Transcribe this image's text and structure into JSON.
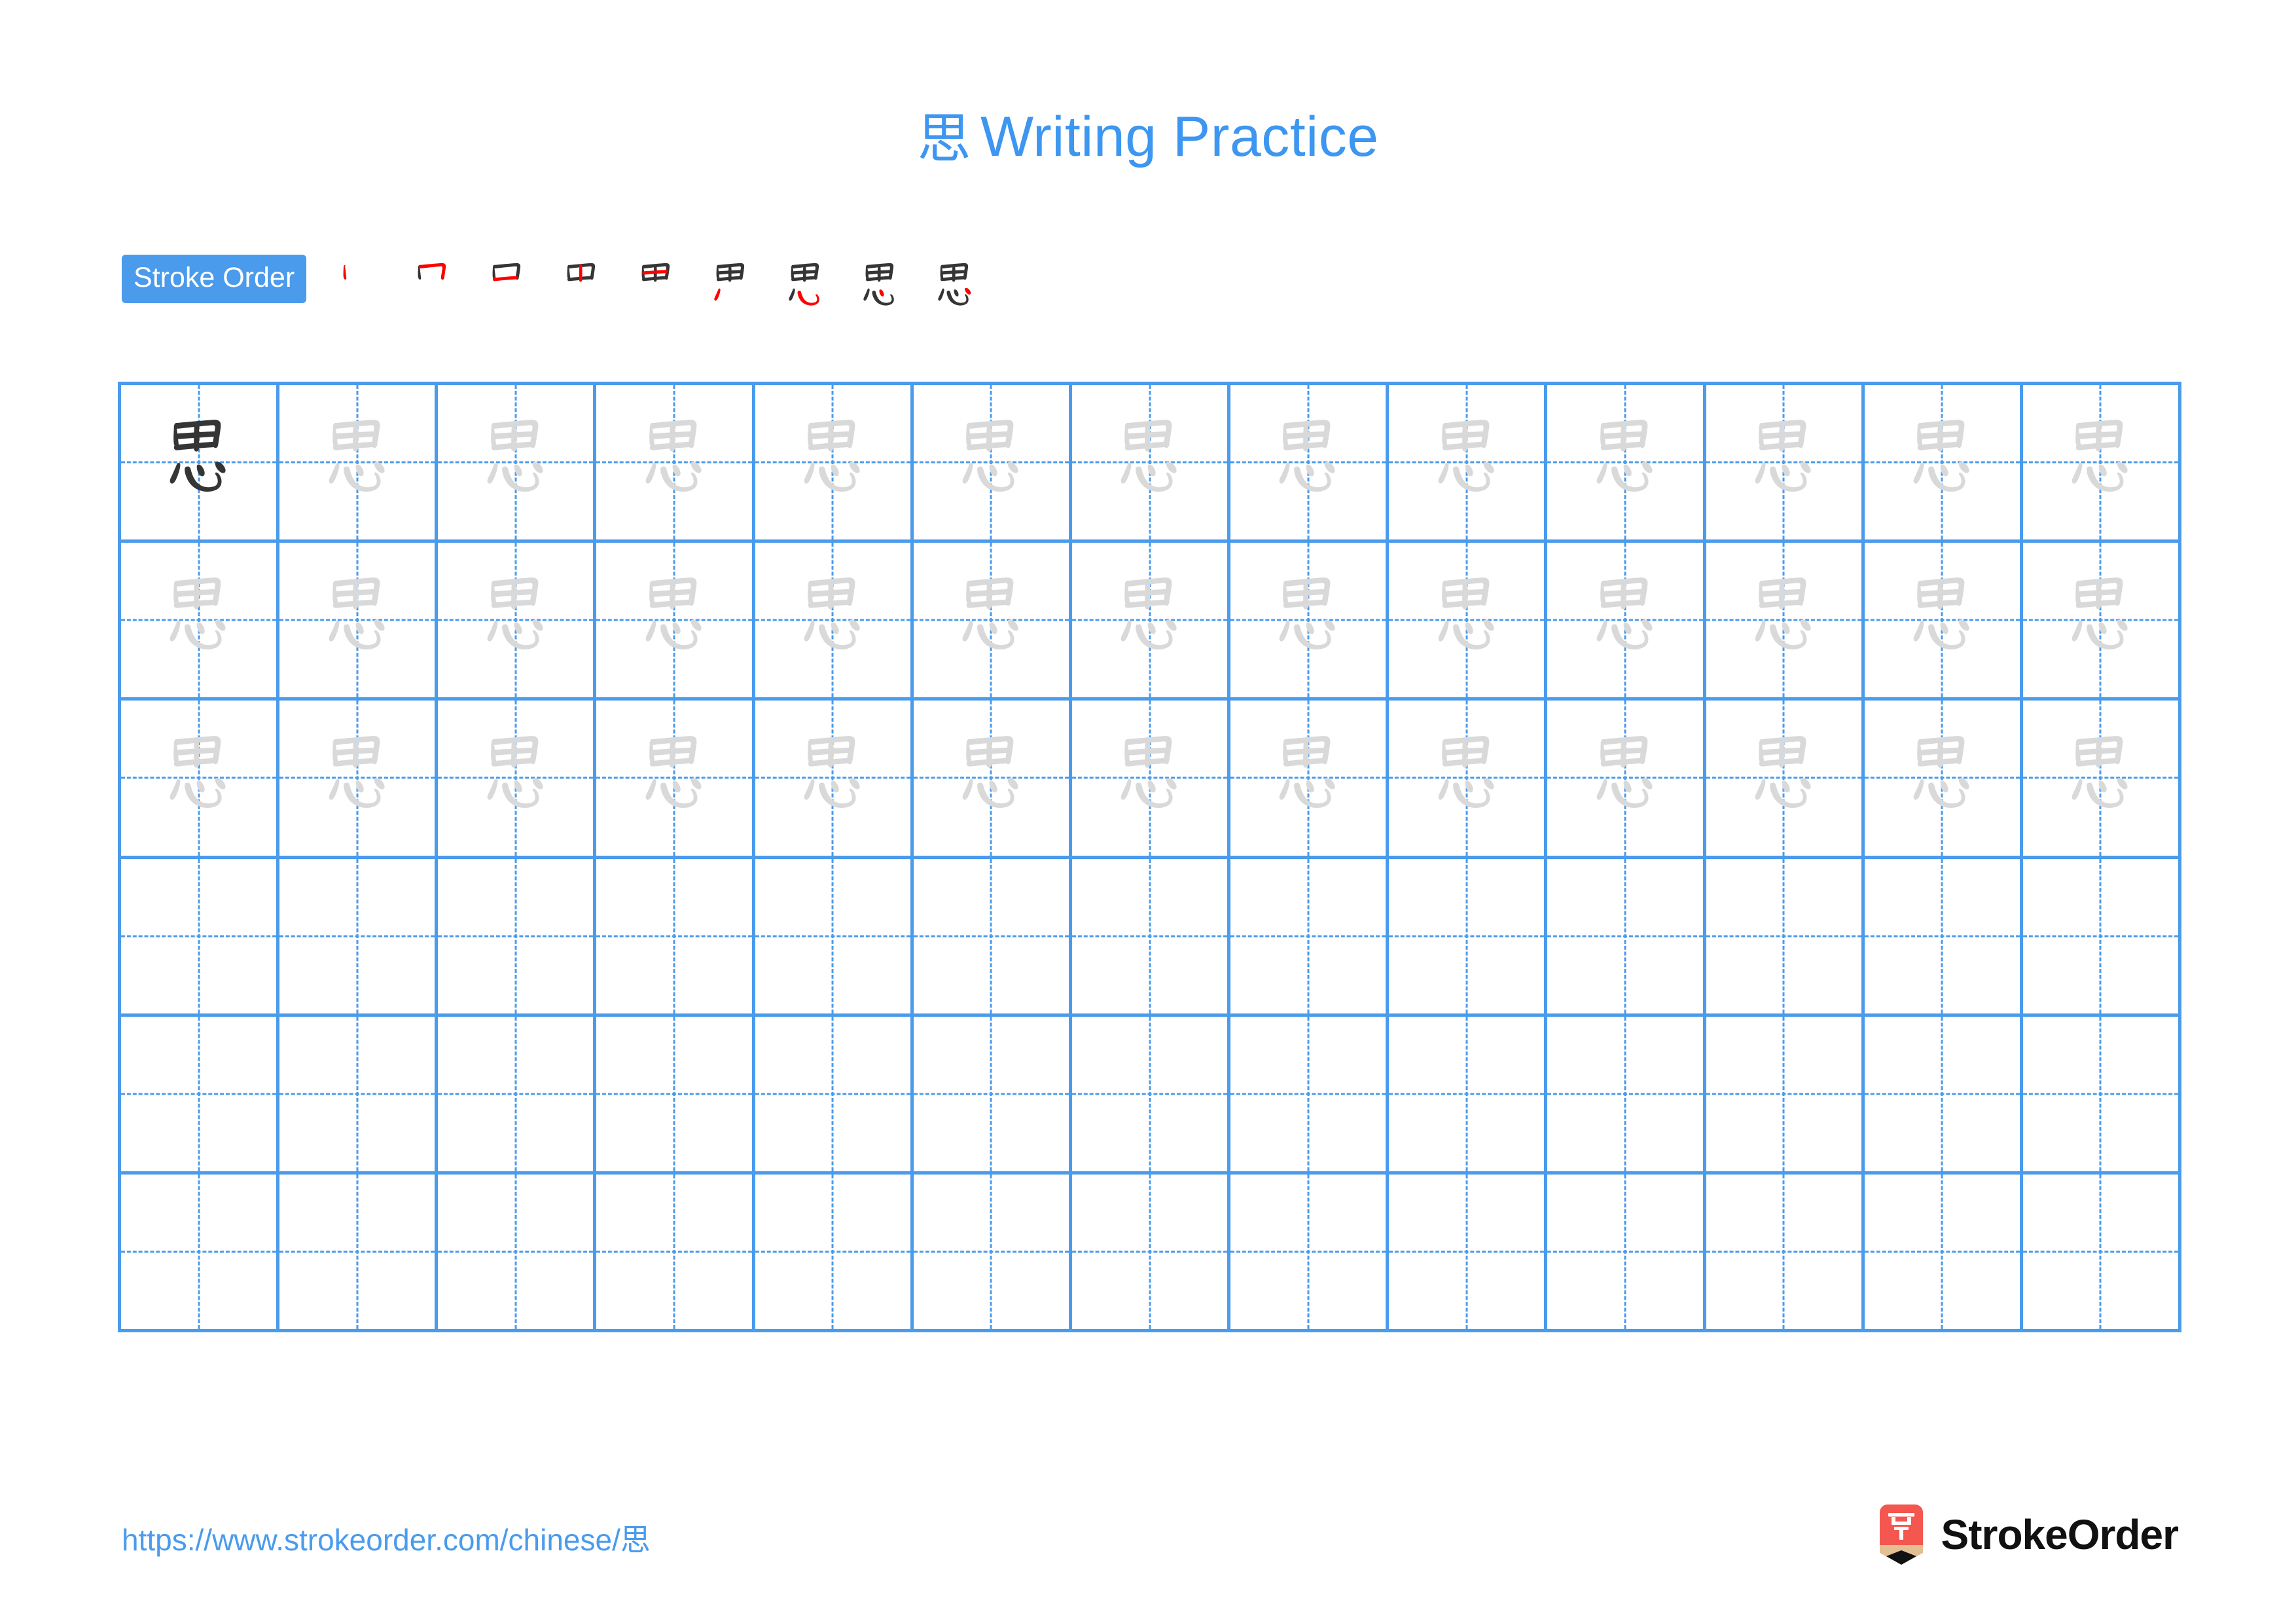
{
  "page": {
    "character": "思",
    "title_prefix": "思",
    "title_text": "Writing Practice",
    "background_color": "#ffffff",
    "accent_color": "#3d96f0",
    "grid_line_color": "#4a9bec",
    "ink_dark_color": "#353535",
    "ink_light_color": "#d9d9d9",
    "new_stroke_color": "#ff0000"
  },
  "stroke_order": {
    "badge_label": "Stroke Order",
    "stroke_count": 9,
    "steps": [
      {
        "index": 1,
        "strokes_shown": 1,
        "new_stroke": 1
      },
      {
        "index": 2,
        "strokes_shown": 2,
        "new_stroke": 2
      },
      {
        "index": 3,
        "strokes_shown": 3,
        "new_stroke": 3
      },
      {
        "index": 4,
        "strokes_shown": 4,
        "new_stroke": 4
      },
      {
        "index": 5,
        "strokes_shown": 5,
        "new_stroke": 5
      },
      {
        "index": 6,
        "strokes_shown": 6,
        "new_stroke": 6
      },
      {
        "index": 7,
        "strokes_shown": 7,
        "new_stroke": 7
      },
      {
        "index": 8,
        "strokes_shown": 8,
        "new_stroke": 8
      },
      {
        "index": 9,
        "strokes_shown": 9,
        "new_stroke": 9
      }
    ]
  },
  "practice_grid": {
    "columns": 13,
    "rows": 6,
    "cell_guides": "dashed-cross",
    "row_fills": [
      {
        "row": 1,
        "cells": [
          "dark",
          "light",
          "light",
          "light",
          "light",
          "light",
          "light",
          "light",
          "light",
          "light",
          "light",
          "light",
          "light"
        ]
      },
      {
        "row": 2,
        "cells": [
          "light",
          "light",
          "light",
          "light",
          "light",
          "light",
          "light",
          "light",
          "light",
          "light",
          "light",
          "light",
          "light"
        ]
      },
      {
        "row": 3,
        "cells": [
          "light",
          "light",
          "light",
          "light",
          "light",
          "light",
          "light",
          "light",
          "light",
          "light",
          "light",
          "light",
          "light"
        ]
      },
      {
        "row": 4,
        "cells": [
          "empty",
          "empty",
          "empty",
          "empty",
          "empty",
          "empty",
          "empty",
          "empty",
          "empty",
          "empty",
          "empty",
          "empty",
          "empty"
        ]
      },
      {
        "row": 5,
        "cells": [
          "empty",
          "empty",
          "empty",
          "empty",
          "empty",
          "empty",
          "empty",
          "empty",
          "empty",
          "empty",
          "empty",
          "empty",
          "empty"
        ]
      },
      {
        "row": 6,
        "cells": [
          "empty",
          "empty",
          "empty",
          "empty",
          "empty",
          "empty",
          "empty",
          "empty",
          "empty",
          "empty",
          "empty",
          "empty",
          "empty"
        ]
      }
    ]
  },
  "footer": {
    "url": "https://www.strokeorder.com/chinese/思",
    "brand_name": "StrokeOrder",
    "brand_mark_glyph": "字",
    "brand_mark_color": "#f4574f"
  }
}
